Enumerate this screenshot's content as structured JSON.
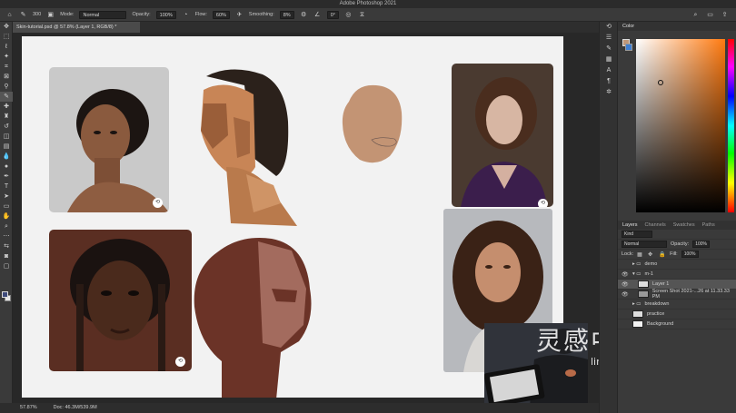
{
  "app": {
    "title": "Adobe Photoshop 2021"
  },
  "options": {
    "mode_label": "Mode:",
    "mode_value": "Normal",
    "opacity_label": "Opacity:",
    "opacity_value": "100%",
    "flow_label": "Flow:",
    "flow_value": "60%",
    "smoothing_label": "Smoothing:",
    "smoothing_value": "8%",
    "angle_value": "0°",
    "brush_size": "300"
  },
  "document": {
    "tab": "Skin-tutorial.psd @ 57.8% (Layer 1, RGB/8) *"
  },
  "status": {
    "zoom": "57.87%",
    "doc": "Doc: 46.3M/539.9M"
  },
  "color_panel": {
    "title": "Color",
    "accent": "#c0987a",
    "bg_accent": "#3f7ed1"
  },
  "layers_panel": {
    "tabs": [
      "Layers",
      "Channels",
      "Swatches",
      "Paths"
    ],
    "filter": "Kind",
    "blend": "Normal",
    "opacity_label": "Opacity:",
    "opacity_value": "100%",
    "lock_label": "Lock:",
    "fill_label": "Fill:",
    "fill_value": "100%",
    "layers": [
      {
        "name": "demo"
      },
      {
        "name": "m-1"
      },
      {
        "name": "Layer 1"
      },
      {
        "name": "Screen Shot 2021-...26 at 11.33.33 PM"
      },
      {
        "name": "breakdown"
      },
      {
        "name": "practice"
      },
      {
        "name": "Background"
      }
    ]
  },
  "watermark": {
    "big": "灵感中国",
    "small": "lingganchina.com"
  }
}
